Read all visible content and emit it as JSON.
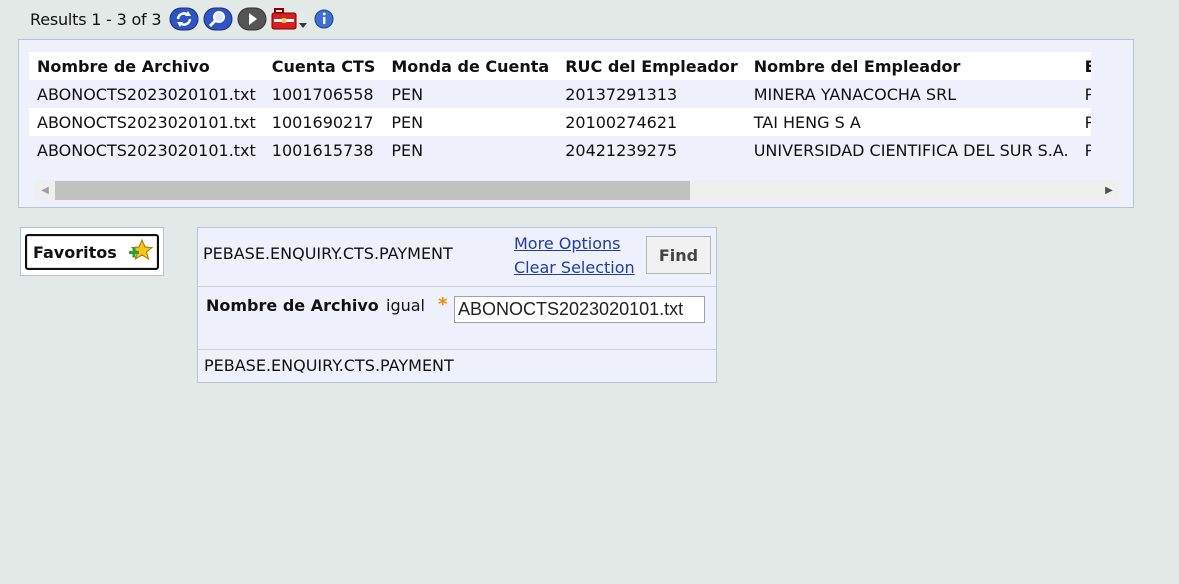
{
  "toolbar": {
    "results_text": "Results 1 - 3 of 3",
    "icons": [
      "refresh-icon",
      "zoom-search-icon",
      "play-next-icon",
      "toolbox-dropdown-icon",
      "info-icon"
    ]
  },
  "grid": {
    "headers": [
      "Nombre de Archivo",
      "Cuenta CTS",
      "Monda de Cuenta",
      "RUC del Empleador",
      "Nombre del Empleador",
      "E"
    ],
    "rows": [
      [
        "ABONOCTS2023020101.txt",
        "1001706558",
        "PEN",
        "20137291313",
        "MINERA YANACOCHA SRL",
        "PRO"
      ],
      [
        "ABONOCTS2023020101.txt",
        "1001690217",
        "PEN",
        "20100274621",
        "TAI HENG S A",
        "PRO"
      ],
      [
        "ABONOCTS2023020101.txt",
        "1001615738",
        "PEN",
        "20421239275",
        "UNIVERSIDAD CIENTIFICA DEL SUR S.A.",
        "PRO"
      ]
    ]
  },
  "favorites": {
    "label": "Favoritos"
  },
  "enquiry": {
    "name": "PEBASE.ENQUIRY.CTS.PAYMENT",
    "more_options": "More Options",
    "clear_selection": "Clear Selection",
    "find_label": "Find",
    "selection": {
      "field_label": "Nombre de Archivo",
      "operator": "igual",
      "value": "ABONOCTS2023020101.txt"
    },
    "footer": "PEBASE.ENQUIRY.CTS.PAYMENT"
  },
  "colors": {
    "background": "#e2e9e7",
    "panel": "#eef1fb",
    "link": "#1f3f9e",
    "required": "#f08a00"
  }
}
